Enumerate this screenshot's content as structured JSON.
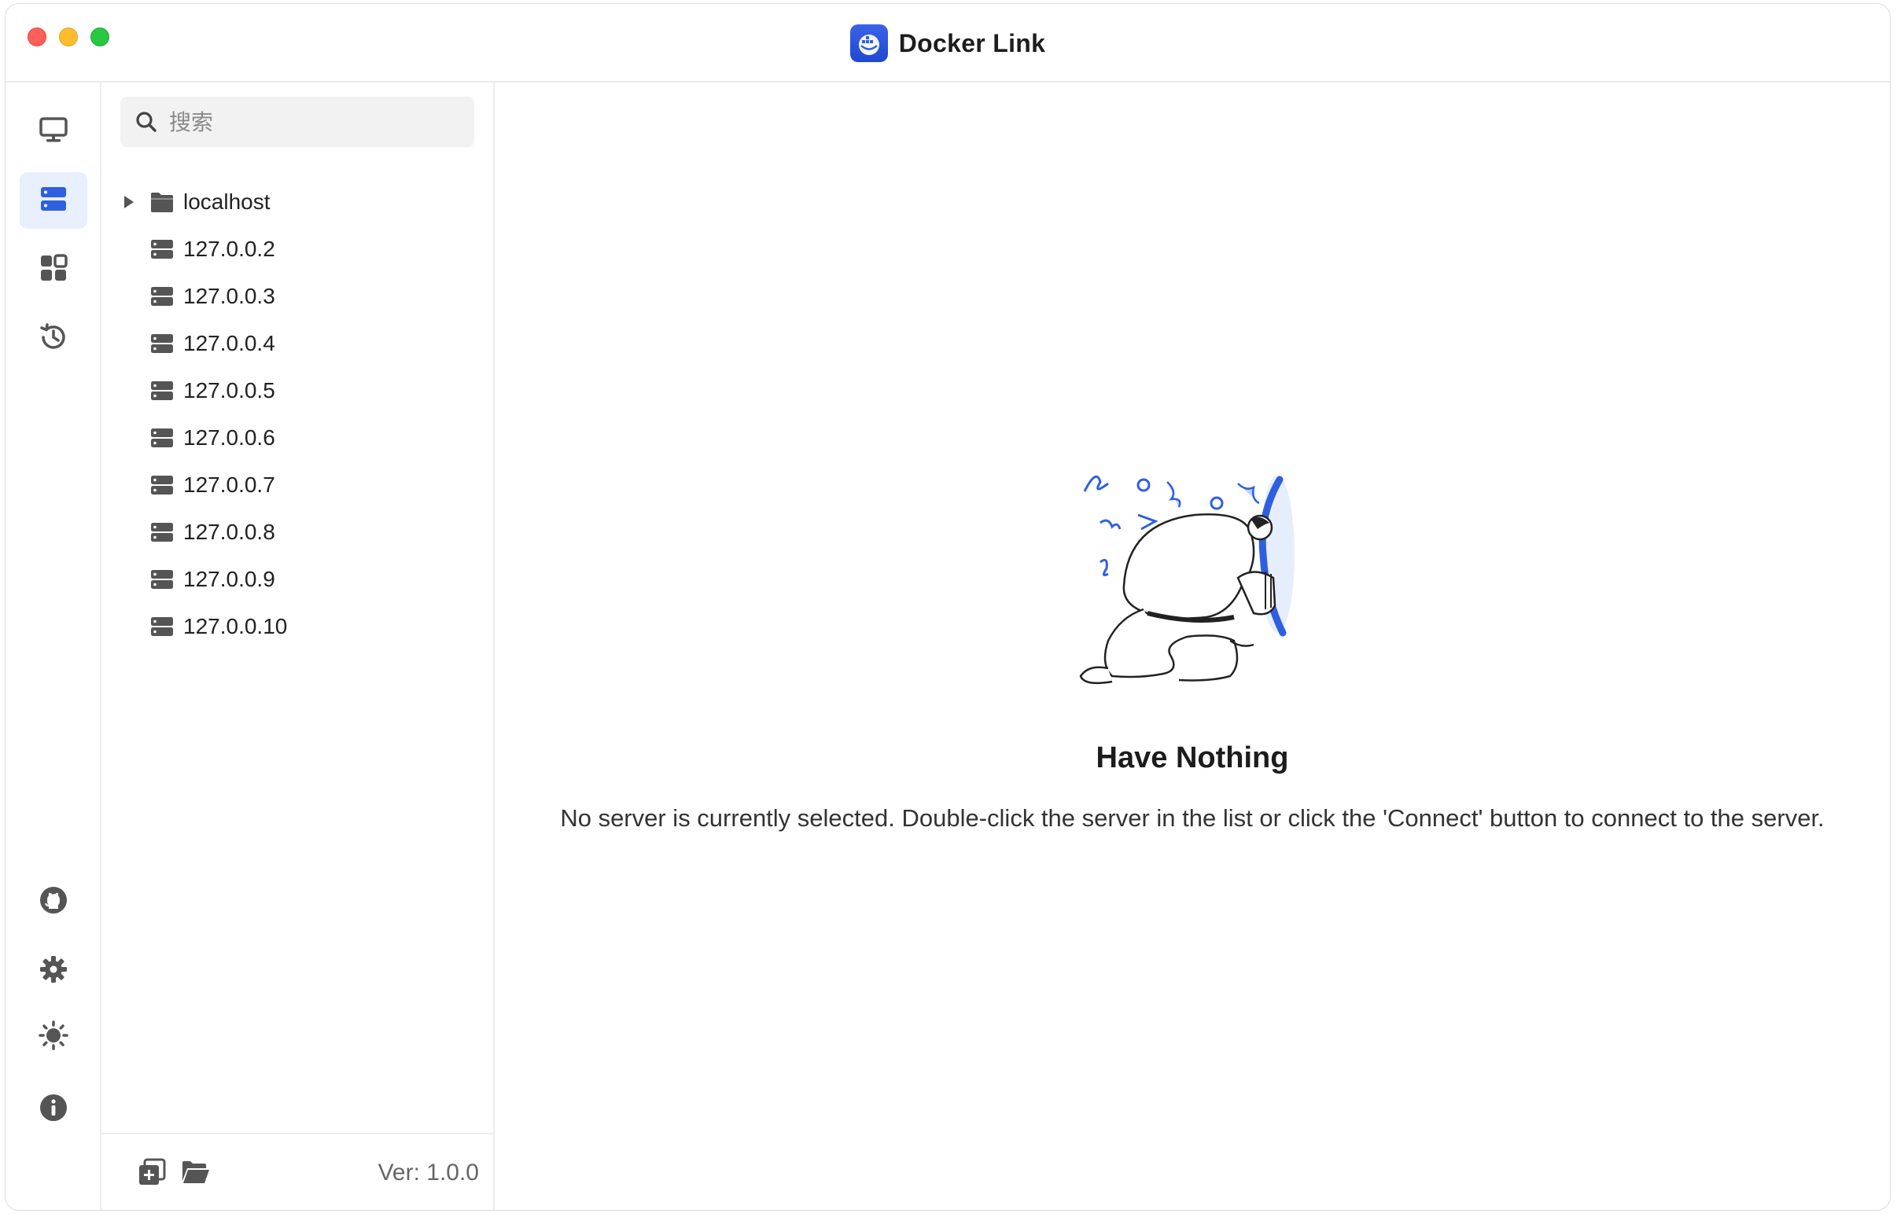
{
  "window": {
    "title": "Docker Link"
  },
  "rail": {
    "items": [
      {
        "icon": "monitor-icon"
      },
      {
        "icon": "server-list-icon",
        "active": true
      },
      {
        "icon": "dashboard-grid-icon"
      },
      {
        "icon": "history-icon"
      },
      {
        "icon": "github-icon"
      },
      {
        "icon": "gear-icon"
      },
      {
        "icon": "sun-icon"
      },
      {
        "icon": "info-icon"
      }
    ]
  },
  "sidebar": {
    "search": {
      "placeholder": "搜索",
      "value": ""
    },
    "tree": {
      "group": {
        "label": "localhost",
        "expanded": false
      },
      "servers": [
        "127.0.0.2",
        "127.0.0.3",
        "127.0.0.4",
        "127.0.0.5",
        "127.0.0.6",
        "127.0.0.7",
        "127.0.0.8",
        "127.0.0.9",
        "127.0.0.10"
      ]
    },
    "footer": {
      "version": "Ver: 1.0.0"
    }
  },
  "main": {
    "empty_title": "Have Nothing",
    "empty_description": "No server is currently selected. Double-click the server in the list or click the 'Connect' button to connect to the server."
  },
  "colors": {
    "accent": "#2f5fe0",
    "rail_active_bg": "#e8effd",
    "icon_gray": "#555555"
  }
}
